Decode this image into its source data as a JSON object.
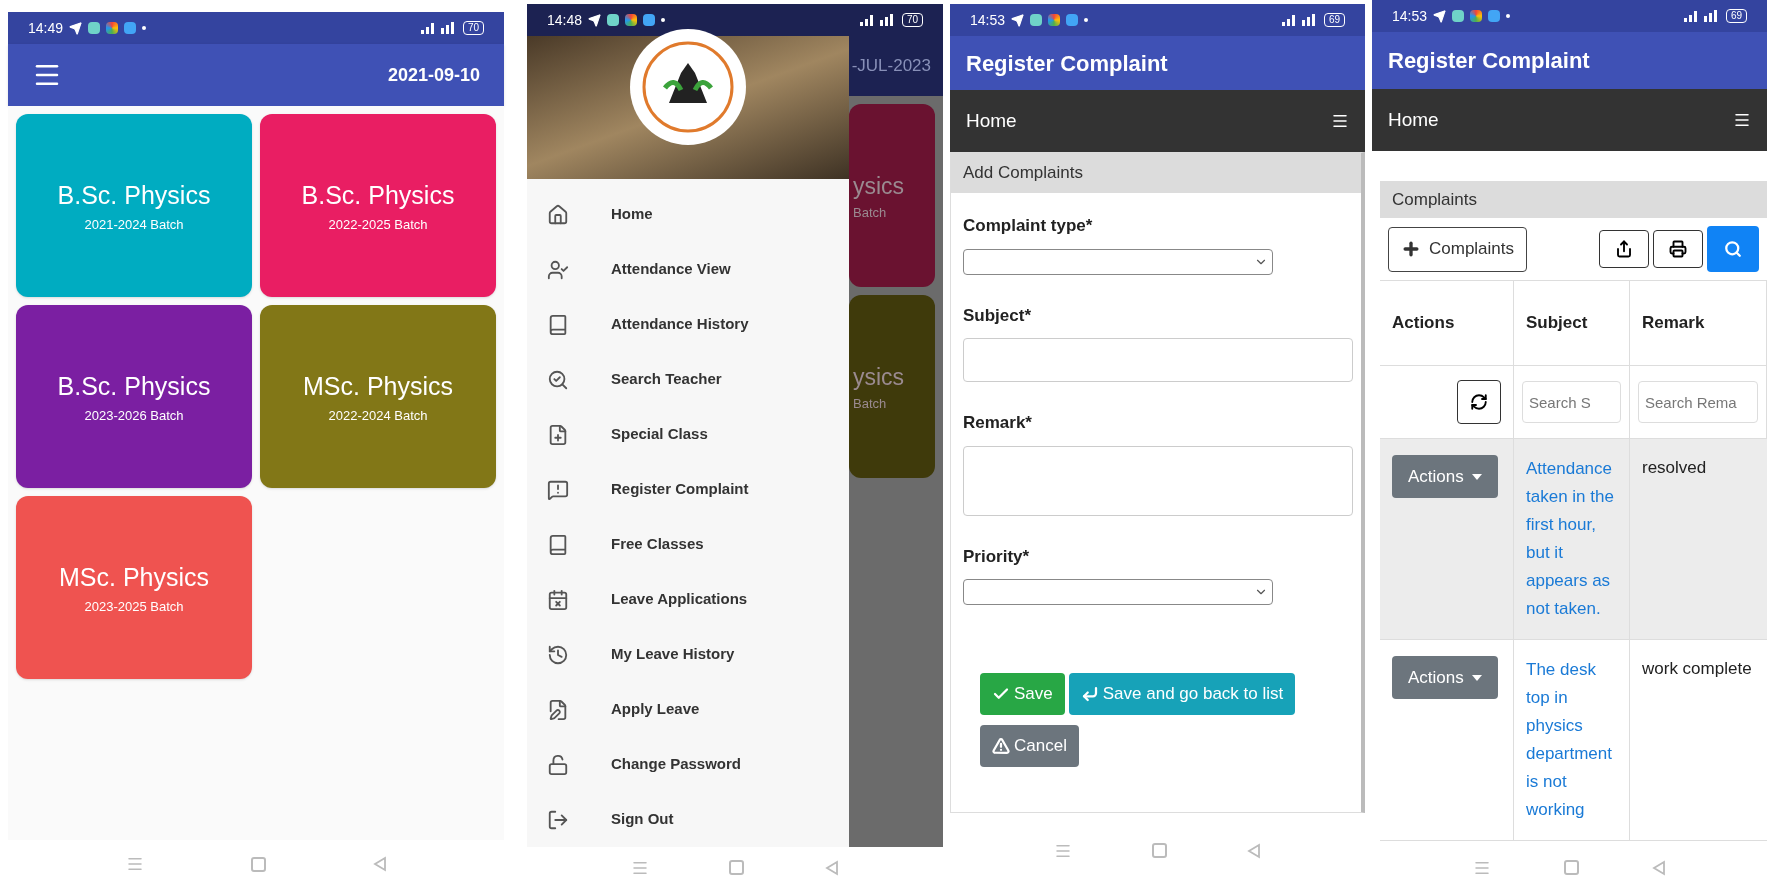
{
  "screens": [
    {
      "kind": "batches",
      "status_bar": {
        "time": "14:49",
        "battery": "70"
      },
      "app_bar": {
        "date": "2021-09-10"
      },
      "tiles": [
        {
          "title": "B.Sc. Physics",
          "subtitle": "2021-2024 Batch",
          "color": "#00acc1"
        },
        {
          "title": "B.Sc. Physics",
          "subtitle": "2022-2025 Batch",
          "color": "#e91e63"
        },
        {
          "title": "B.Sc. Physics",
          "subtitle": "2023-2026 Batch",
          "color": "#7b1fa2"
        },
        {
          "title": "MSc. Physics",
          "subtitle": "2022-2024 Batch",
          "color": "#827717"
        },
        {
          "title": "MSc. Physics",
          "subtitle": "2023-2025 Batch",
          "color": "#ef5350"
        }
      ]
    },
    {
      "kind": "drawer",
      "status_bar": {
        "time": "14:48",
        "battery": "70"
      },
      "background": {
        "date": "-JUL-2023",
        "tiles": [
          {
            "title": "ysics",
            "subtitle": "Batch",
            "color": "#6a1230"
          },
          {
            "title": "ysics",
            "subtitle": "Batch",
            "color": "#3f3a0b"
          }
        ]
      },
      "menu": [
        {
          "label": "Home"
        },
        {
          "label": "Attendance View"
        },
        {
          "label": "Attendance History"
        },
        {
          "label": "Search Teacher"
        },
        {
          "label": "Special Class"
        },
        {
          "label": "Register Complaint"
        },
        {
          "label": "Free Classes"
        },
        {
          "label": "Leave Applications"
        },
        {
          "label": "My Leave History"
        },
        {
          "label": "Apply Leave"
        },
        {
          "label": "Change Password"
        },
        {
          "label": "Sign Out"
        }
      ]
    },
    {
      "kind": "form",
      "status_bar": {
        "time": "14:53",
        "battery": "69"
      },
      "title": "Register Complaint",
      "nav": {
        "label": "Home"
      },
      "panel_title": "Add Complaints",
      "fields": [
        {
          "label": "Complaint type*",
          "kind": "select"
        },
        {
          "label": "Subject*",
          "kind": "text"
        },
        {
          "label": "Remark*",
          "kind": "textarea"
        },
        {
          "label": "Priority*",
          "kind": "select"
        }
      ],
      "buttons": [
        {
          "label": "Save",
          "kind": "save"
        },
        {
          "label": "Save and go back to list",
          "kind": "save_back"
        },
        {
          "label": "Cancel",
          "kind": "cancel"
        }
      ]
    },
    {
      "kind": "list",
      "status_bar": {
        "time": "14:53",
        "battery": "69"
      },
      "title": "Register Complaint",
      "nav": {
        "label": "Home"
      },
      "panel_title": "Complaints",
      "add_button": "Complaints",
      "table": {
        "columns": [
          "Actions",
          "Subject",
          "Remark"
        ],
        "filters": [
          {
            "placeholder": "Search S"
          },
          {
            "placeholder": "Search Rema"
          }
        ],
        "rows": [
          {
            "action": "Actions",
            "subject": "Attendance taken in the first hour, but it appears as not taken.",
            "remark": "resolved"
          },
          {
            "action": "Actions",
            "subject": "The desk top in physics department is not working",
            "remark": "work complete"
          }
        ]
      }
    }
  ]
}
